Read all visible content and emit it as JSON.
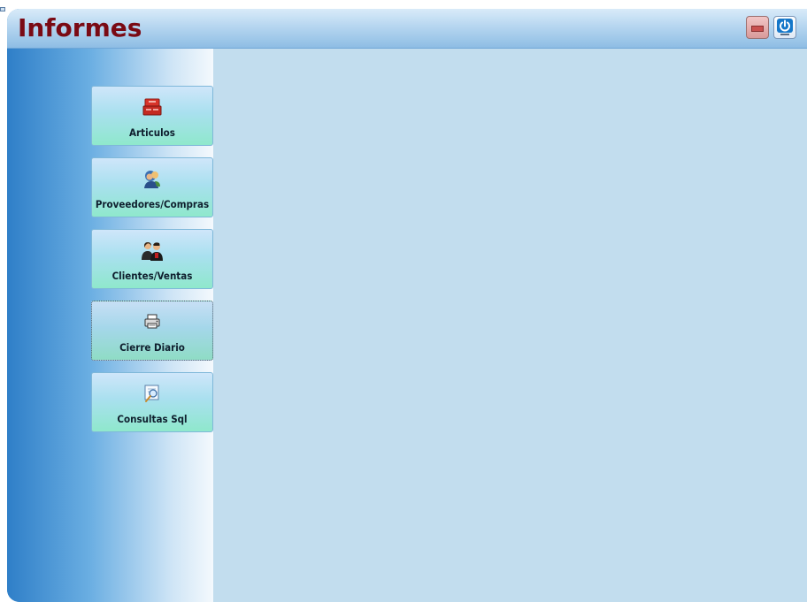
{
  "window": {
    "title": "Informes",
    "title_color": "#7a0a14",
    "minimize_icon": "minimize-icon",
    "power_icon": "power-icon"
  },
  "sidebar": {
    "items": [
      {
        "label": "Articulos",
        "icon": "boxes-icon",
        "active": false
      },
      {
        "label": "Proveedores/Compras",
        "icon": "supplier-icon",
        "active": false
      },
      {
        "label": "Clientes/Ventas",
        "icon": "customers-icon",
        "active": false
      },
      {
        "label": "Cierre Diario",
        "icon": "printer-icon",
        "active": true
      },
      {
        "label": "Consultas Sql",
        "icon": "query-icon",
        "active": false
      }
    ]
  },
  "colors": {
    "content_background": "#c2ddee",
    "button_gradient_top": "#cfe6fa",
    "button_gradient_bottom": "#8fe8cc"
  }
}
